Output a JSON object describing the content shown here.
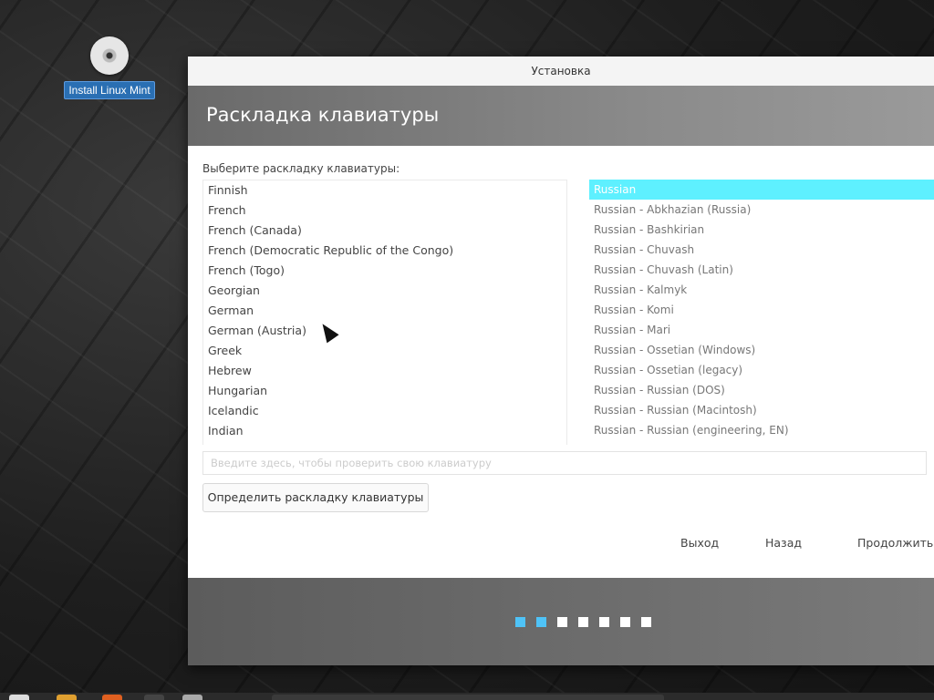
{
  "desktop": {
    "icon_label": "Install Linux Mint",
    "icon_name": "disc-icon"
  },
  "window": {
    "title": "Установка",
    "header_title": "Раскладка клавиатуры",
    "prompt": "Выберите раскладку клавиатуры:",
    "layouts": [
      "Finnish",
      "French",
      "French (Canada)",
      "French (Democratic Republic of the Congo)",
      "French (Togo)",
      "Georgian",
      "German",
      "German (Austria)",
      "Greek",
      "Hebrew",
      "Hungarian",
      "Icelandic",
      "Indian"
    ],
    "variants": [
      "Russian",
      "Russian - Abkhazian (Russia)",
      "Russian - Bashkirian",
      "Russian - Chuvash",
      "Russian - Chuvash (Latin)",
      "Russian - Kalmyk",
      "Russian - Komi",
      "Russian - Mari",
      "Russian - Ossetian (Windows)",
      "Russian - Ossetian (legacy)",
      "Russian - Russian (DOS)",
      "Russian - Russian (Macintosh)",
      "Russian - Russian (engineering, EN)"
    ],
    "selected_variant_index": 0,
    "test_input_placeholder": "Введите здесь, чтобы проверить свою клавиатуру",
    "detect_button": "Определить раскладку клавиатуры",
    "quit_button": "Выход",
    "back_button": "Назад",
    "continue_button": "Продолжить",
    "progress": {
      "total_steps": 7,
      "current_step": 2
    },
    "colors": {
      "selection": "#5ef0ff",
      "active_dot": "#4fc3f7"
    }
  }
}
